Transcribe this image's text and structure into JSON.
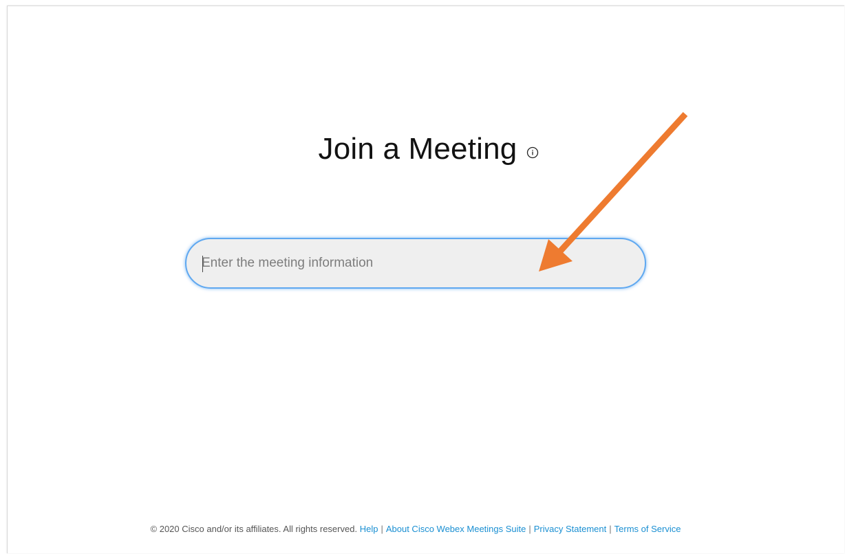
{
  "main": {
    "title": "Join a Meeting",
    "search": {
      "placeholder": "Enter the meeting information",
      "value": ""
    }
  },
  "footer": {
    "copyright": "© 2020 Cisco and/or its affiliates. All rights reserved.",
    "links": [
      {
        "label": "Help"
      },
      {
        "label": "About Cisco Webex Meetings Suite"
      },
      {
        "label": "Privacy Statement"
      },
      {
        "label": "Terms of Service"
      }
    ],
    "separator": "|"
  },
  "icons": {
    "title_info": "info-circle-icon",
    "annotation": "orange-arrow-annotation"
  },
  "colors": {
    "link": "#1a8fd2",
    "focus_border": "#5fa8f0",
    "annotation_arrow": "#ee7b30"
  }
}
